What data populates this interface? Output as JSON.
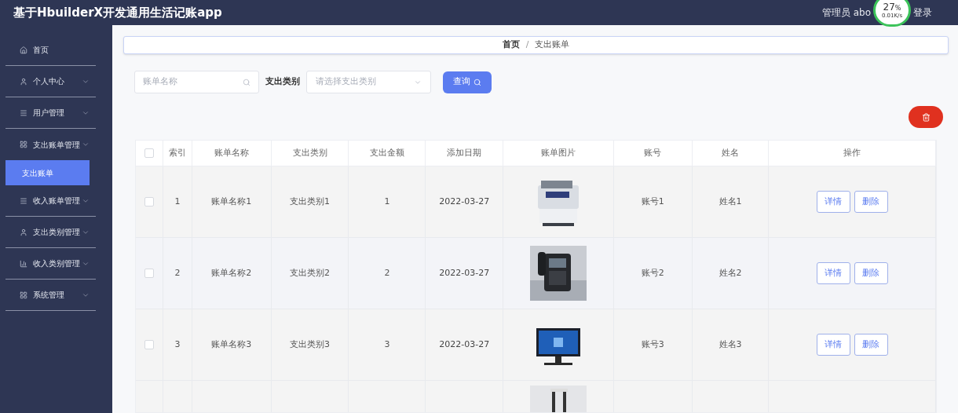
{
  "header": {
    "title": "基于HbuilderX开发通用生活记账app",
    "user_text": "管理员 abo",
    "logout_text": "登录"
  },
  "net_widget": {
    "percent": "27",
    "unit": "%",
    "speed": "0.01K/s"
  },
  "sidebar": {
    "items": [
      {
        "label": "首页",
        "has_submenu": false,
        "expanded": false
      },
      {
        "label": "个人中心",
        "has_submenu": true,
        "expanded": false
      },
      {
        "label": "用户管理",
        "has_submenu": true,
        "expanded": false
      },
      {
        "label": "支出账单管理",
        "has_submenu": true,
        "expanded": true,
        "children": [
          {
            "label": "支出账单",
            "selected": true
          }
        ]
      },
      {
        "label": "收入账单管理",
        "has_submenu": true,
        "expanded": false
      },
      {
        "label": "支出类别管理",
        "has_submenu": true,
        "expanded": false
      },
      {
        "label": "收入类别管理",
        "has_submenu": true,
        "expanded": false
      },
      {
        "label": "系统管理",
        "has_submenu": true,
        "expanded": false
      }
    ]
  },
  "breadcrumb": [
    "首页",
    "支出账单"
  ],
  "breadcrumb_separator": "/",
  "search": {
    "name_placeholder": "账单名称",
    "category_label": "支出类别",
    "category_placeholder": "请选择支出类别",
    "query_button": "查询"
  },
  "table": {
    "select_all_checked": false,
    "columns": [
      "索引",
      "账单名称",
      "支出类别",
      "支出金额",
      "添加日期",
      "账单图片",
      "账号",
      "姓名",
      "操作"
    ],
    "rows": [
      {
        "checked": false,
        "cells": [
          "1",
          "账单名称1",
          "支出类别1",
          "1",
          "2022-03-27"
        ],
        "image": {
          "kind": "picture"
        },
        "cells_after": [
          "账号1",
          "姓名1"
        ],
        "actions": [
          "详情",
          "删除"
        ]
      },
      {
        "checked": false,
        "cells": [
          "2",
          "账单名称2",
          "支出类别2",
          "2",
          "2022-03-27"
        ],
        "image": {
          "kind": "picture"
        },
        "cells_after": [
          "账号2",
          "姓名2"
        ],
        "actions": [
          "详情",
          "删除"
        ]
      },
      {
        "checked": false,
        "cells": [
          "3",
          "账单名称3",
          "支出类别3",
          "3",
          "2022-03-27"
        ],
        "image": {
          "kind": "picture"
        },
        "cells_after": [
          "账号3",
          "姓名3"
        ],
        "actions": [
          "详情",
          "删除"
        ]
      }
    ],
    "more_rows_below": true
  }
}
